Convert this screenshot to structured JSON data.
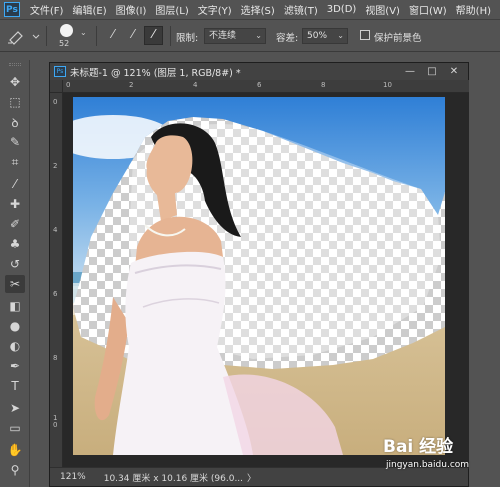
{
  "app": {
    "logo": "Ps"
  },
  "menu": [
    "文件(F)",
    "编辑(E)",
    "图像(I)",
    "图层(L)",
    "文字(Y)",
    "选择(S)",
    "滤镜(T)",
    "3D(D)",
    "视图(V)",
    "窗口(W)",
    "帮助(H)"
  ],
  "options": {
    "brush_size": "52",
    "limits_label": "限制:",
    "limits_value": "不连续",
    "tolerance_label": "容差:",
    "tolerance_value": "50%",
    "protect_label": "保护前景色",
    "protect_checked": false
  },
  "tools": [
    {
      "name": "move-tool-icon",
      "glyph": "✥"
    },
    {
      "name": "marquee-tool-icon",
      "glyph": "⬚"
    },
    {
      "name": "lasso-tool-icon",
      "glyph": "ꝺ"
    },
    {
      "name": "quick-select-tool-icon",
      "glyph": "✎"
    },
    {
      "name": "crop-tool-icon",
      "glyph": "⌗"
    },
    {
      "name": "eyedropper-tool-icon",
      "glyph": "⁄"
    },
    {
      "name": "healing-brush-tool-icon",
      "glyph": "✚"
    },
    {
      "name": "brush-tool-icon",
      "glyph": "✐"
    },
    {
      "name": "clone-stamp-tool-icon",
      "glyph": "♣"
    },
    {
      "name": "history-brush-tool-icon",
      "glyph": "↺"
    },
    {
      "name": "background-eraser-tool-icon",
      "glyph": "✂",
      "active": true
    },
    {
      "name": "gradient-tool-icon",
      "glyph": "◧"
    },
    {
      "name": "blur-tool-icon",
      "glyph": "●"
    },
    {
      "name": "dodge-tool-icon",
      "glyph": "◐"
    },
    {
      "name": "pen-tool-icon",
      "glyph": "✒"
    },
    {
      "name": "type-tool-icon",
      "glyph": "T"
    },
    {
      "name": "path-select-tool-icon",
      "glyph": "➤"
    },
    {
      "name": "rectangle-tool-icon",
      "glyph": "▭"
    },
    {
      "name": "hand-tool-icon",
      "glyph": "✋"
    },
    {
      "name": "zoom-tool-icon",
      "glyph": "⚲"
    }
  ],
  "document": {
    "title": "未标题-1 @ 121% (图层 1, RGB/8#) *",
    "zoom": "121%",
    "doc_info": "10.34 厘米 x 10.16 厘米 (96.0...",
    "info_arrow": "〉"
  },
  "ruler": {
    "h_labels": [
      "0",
      "2",
      "4",
      "6",
      "8",
      "10"
    ],
    "v_labels": [
      "0",
      "2",
      "4",
      "6",
      "8",
      "1 0"
    ]
  },
  "watermark": {
    "logo": "Bai 经验",
    "url": "jingyan.baidu.com"
  },
  "colors": {
    "accent": "#3ea8f4",
    "panel": "#535353",
    "canvas_bg": "#282828"
  }
}
